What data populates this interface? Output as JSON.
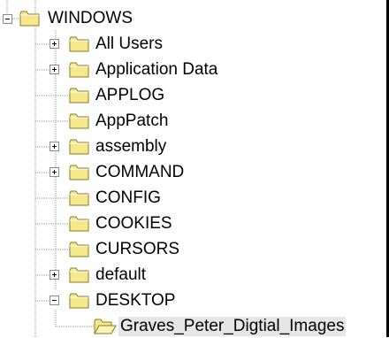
{
  "tree": {
    "root": {
      "label": "WINDOWS",
      "state": "expanded",
      "icon": "folder-icon"
    },
    "items": [
      {
        "label": "All Users",
        "has_children": true,
        "state": "collapsed",
        "icon": "folder-icon"
      },
      {
        "label": "Application Data",
        "has_children": true,
        "state": "collapsed",
        "icon": "folder-icon"
      },
      {
        "label": "APPLOG",
        "has_children": false,
        "icon": "folder-icon"
      },
      {
        "label": "AppPatch",
        "has_children": false,
        "icon": "folder-icon"
      },
      {
        "label": "assembly",
        "has_children": true,
        "state": "collapsed",
        "icon": "folder-icon"
      },
      {
        "label": "COMMAND",
        "has_children": true,
        "state": "collapsed",
        "icon": "folder-icon"
      },
      {
        "label": "CONFIG",
        "has_children": false,
        "icon": "folder-icon"
      },
      {
        "label": "COOKIES",
        "has_children": false,
        "icon": "folder-icon"
      },
      {
        "label": "CURSORS",
        "has_children": false,
        "icon": "folder-icon"
      },
      {
        "label": "default",
        "has_children": true,
        "state": "collapsed",
        "icon": "folder-icon"
      },
      {
        "label": "DESKTOP",
        "has_children": true,
        "state": "expanded",
        "icon": "folder-icon"
      }
    ],
    "child": {
      "label": "Graves_Peter_Digtial_Images",
      "state": "selected",
      "icon": "folder-open-icon"
    },
    "colors": {
      "folder_fill": "#f6e98c",
      "folder_stroke": "#8a7a2a",
      "selection_bg": "#e6e6e6",
      "tree_lines": "#9a9a9a"
    }
  }
}
